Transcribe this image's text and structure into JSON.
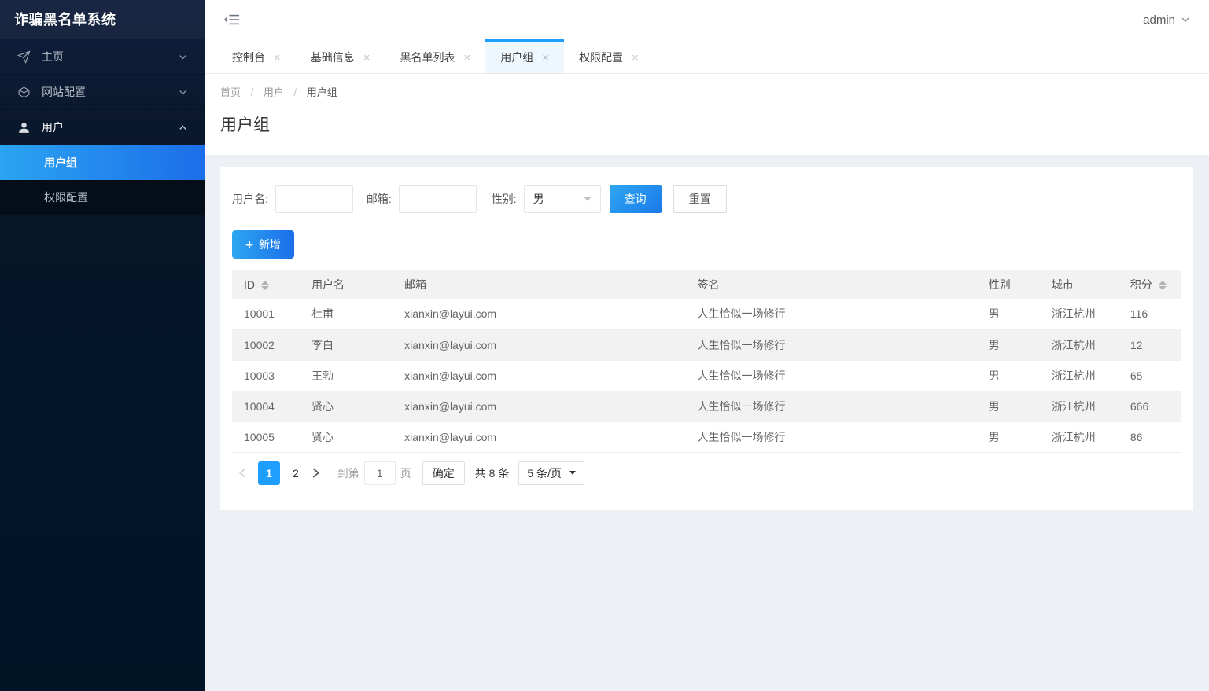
{
  "app": {
    "title": "诈骗黑名单系统"
  },
  "topbar": {
    "user": "admin"
  },
  "sidebar": {
    "items": [
      {
        "label": "主页"
      },
      {
        "label": "网站配置"
      },
      {
        "label": "用户"
      }
    ],
    "submenu": [
      {
        "label": "用户组"
      },
      {
        "label": "权限配置"
      }
    ]
  },
  "tabs": [
    {
      "label": "控制台"
    },
    {
      "label": "基础信息"
    },
    {
      "label": "黑名单列表"
    },
    {
      "label": "用户组"
    },
    {
      "label": "权限配置"
    }
  ],
  "tab_close_glyph": "×",
  "breadcrumb": {
    "items": [
      "首页",
      "用户",
      "用户组"
    ],
    "separator": "/"
  },
  "page": {
    "title": "用户组"
  },
  "search": {
    "username_label": "用户名:",
    "email_label": "邮箱:",
    "gender_label": "性别:",
    "gender_value": "男",
    "submit_label": "查询",
    "reset_label": "重置"
  },
  "toolbar": {
    "add_label": "新增",
    "plus_glyph": "+"
  },
  "table": {
    "headers": {
      "id": "ID",
      "username": "用户名",
      "email": "邮箱",
      "sign": "签名",
      "gender": "性别",
      "city": "城市",
      "score": "积分"
    },
    "rows": [
      {
        "id": "10001",
        "username": "杜甫",
        "email": "xianxin@layui.com",
        "sign": "人生恰似一场修行",
        "gender": "男",
        "city": "浙江杭州",
        "score": "116"
      },
      {
        "id": "10002",
        "username": "李白",
        "email": "xianxin@layui.com",
        "sign": "人生恰似一场修行",
        "gender": "男",
        "city": "浙江杭州",
        "score": "12"
      },
      {
        "id": "10003",
        "username": "王勃",
        "email": "xianxin@layui.com",
        "sign": "人生恰似一场修行",
        "gender": "男",
        "city": "浙江杭州",
        "score": "65"
      },
      {
        "id": "10004",
        "username": "贤心",
        "email": "xianxin@layui.com",
        "sign": "人生恰似一场修行",
        "gender": "男",
        "city": "浙江杭州",
        "score": "666"
      },
      {
        "id": "10005",
        "username": "贤心",
        "email": "xianxin@layui.com",
        "sign": "人生恰似一场修行",
        "gender": "男",
        "city": "浙江杭州",
        "score": "86"
      }
    ]
  },
  "pagination": {
    "pages": [
      "1",
      "2"
    ],
    "current": "1",
    "goto_label": "到第",
    "goto_value": "1",
    "page_unit": "页",
    "confirm_label": "确定",
    "total_label": "共 8 条",
    "per_page_label": "5 条/页"
  },
  "colors": {
    "accent": "#1E9FFF",
    "accent_gradient_start": "#2ea6f1",
    "accent_gradient_end": "#1b6fe9",
    "sidebar_bg_top": "#101f3d",
    "sidebar_bg_bottom": "#011527",
    "table_stripe": "#f2f2f2",
    "tab_active_bg": "#eef6fe"
  }
}
